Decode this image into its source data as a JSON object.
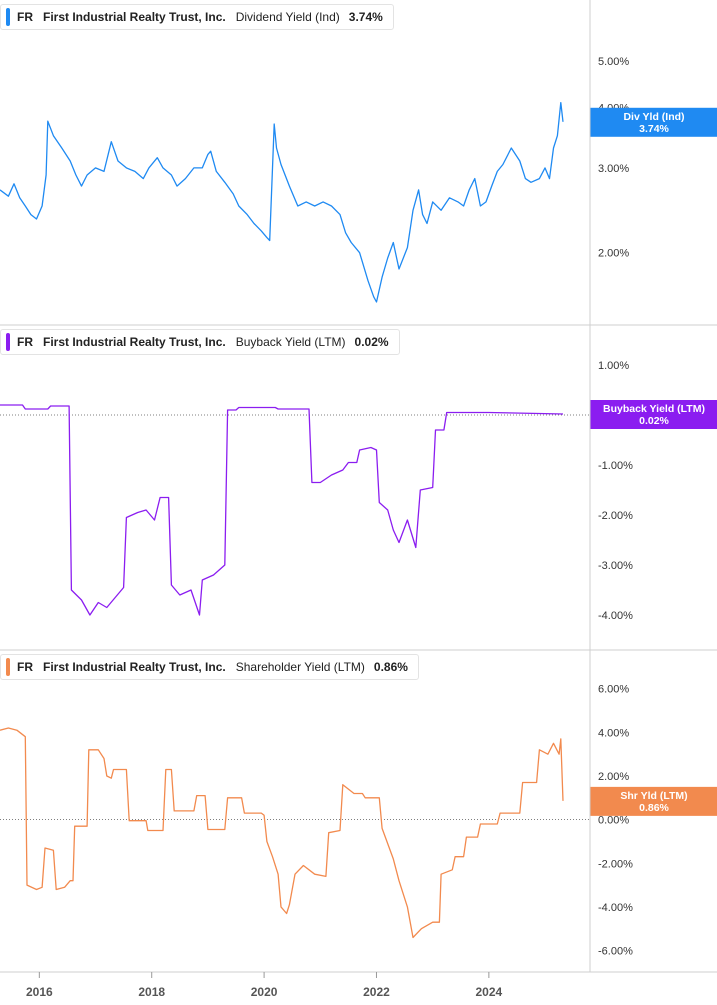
{
  "chart_data": {
    "type": "line",
    "x_axis": {
      "tick_labels": [
        "2016",
        "2018",
        "2020",
        "2022",
        "2024"
      ],
      "range": [
        2015.3,
        2025.8
      ]
    },
    "panels": [
      {
        "ticker": "FR",
        "company": "First Industrial Realty Trust, Inc.",
        "metric": "Dividend Yield (Ind)",
        "value": "3.74%",
        "color": "#1f8af2",
        "scale": "log",
        "ylim": [
          1.45,
          5.8
        ],
        "y_ticks": [
          {
            "v": 5.0,
            "label": "5.00%"
          },
          {
            "v": 4.0,
            "label": "4.00%"
          },
          {
            "v": 3.0,
            "label": "3.00%"
          },
          {
            "v": 2.0,
            "label": "2.00%"
          }
        ],
        "badge": {
          "label": "Div Yld (Ind)",
          "value": "3.74%",
          "at": 3.74
        },
        "zero_line": false,
        "series": [
          {
            "x": 2015.3,
            "y": 2.7
          },
          {
            "x": 2015.45,
            "y": 2.62
          },
          {
            "x": 2015.55,
            "y": 2.78
          },
          {
            "x": 2015.65,
            "y": 2.6
          },
          {
            "x": 2015.75,
            "y": 2.5
          },
          {
            "x": 2015.85,
            "y": 2.4
          },
          {
            "x": 2015.95,
            "y": 2.35
          },
          {
            "x": 2016.05,
            "y": 2.5
          },
          {
            "x": 2016.12,
            "y": 2.9
          },
          {
            "x": 2016.15,
            "y": 3.75
          },
          {
            "x": 2016.25,
            "y": 3.5
          },
          {
            "x": 2016.4,
            "y": 3.3
          },
          {
            "x": 2016.55,
            "y": 3.1
          },
          {
            "x": 2016.65,
            "y": 2.9
          },
          {
            "x": 2016.75,
            "y": 2.75
          },
          {
            "x": 2016.85,
            "y": 2.9
          },
          {
            "x": 2017.0,
            "y": 3.0
          },
          {
            "x": 2017.15,
            "y": 2.95
          },
          {
            "x": 2017.28,
            "y": 3.4
          },
          {
            "x": 2017.4,
            "y": 3.1
          },
          {
            "x": 2017.55,
            "y": 3.0
          },
          {
            "x": 2017.7,
            "y": 2.95
          },
          {
            "x": 2017.85,
            "y": 2.85
          },
          {
            "x": 2017.95,
            "y": 3.0
          },
          {
            "x": 2018.1,
            "y": 3.15
          },
          {
            "x": 2018.2,
            "y": 3.0
          },
          {
            "x": 2018.35,
            "y": 2.9
          },
          {
            "x": 2018.45,
            "y": 2.75
          },
          {
            "x": 2018.6,
            "y": 2.85
          },
          {
            "x": 2018.75,
            "y": 3.0
          },
          {
            "x": 2018.9,
            "y": 3.0
          },
          {
            "x": 2019.0,
            "y": 3.2
          },
          {
            "x": 2019.05,
            "y": 3.25
          },
          {
            "x": 2019.15,
            "y": 2.95
          },
          {
            "x": 2019.3,
            "y": 2.8
          },
          {
            "x": 2019.45,
            "y": 2.65
          },
          {
            "x": 2019.55,
            "y": 2.5
          },
          {
            "x": 2019.7,
            "y": 2.4
          },
          {
            "x": 2019.82,
            "y": 2.3
          },
          {
            "x": 2019.95,
            "y": 2.22
          },
          {
            "x": 2020.05,
            "y": 2.15
          },
          {
            "x": 2020.1,
            "y": 2.12
          },
          {
            "x": 2020.18,
            "y": 3.7
          },
          {
            "x": 2020.22,
            "y": 3.3
          },
          {
            "x": 2020.3,
            "y": 3.05
          },
          {
            "x": 2020.45,
            "y": 2.75
          },
          {
            "x": 2020.6,
            "y": 2.5
          },
          {
            "x": 2020.75,
            "y": 2.55
          },
          {
            "x": 2020.9,
            "y": 2.5
          },
          {
            "x": 2021.05,
            "y": 2.55
          },
          {
            "x": 2021.2,
            "y": 2.5
          },
          {
            "x": 2021.35,
            "y": 2.4
          },
          {
            "x": 2021.45,
            "y": 2.2
          },
          {
            "x": 2021.55,
            "y": 2.1
          },
          {
            "x": 2021.7,
            "y": 2.0
          },
          {
            "x": 2021.85,
            "y": 1.75
          },
          {
            "x": 2021.95,
            "y": 1.62
          },
          {
            "x": 2022.0,
            "y": 1.58
          },
          {
            "x": 2022.1,
            "y": 1.78
          },
          {
            "x": 2022.2,
            "y": 1.95
          },
          {
            "x": 2022.3,
            "y": 2.1
          },
          {
            "x": 2022.4,
            "y": 1.85
          },
          {
            "x": 2022.55,
            "y": 2.05
          },
          {
            "x": 2022.65,
            "y": 2.45
          },
          {
            "x": 2022.75,
            "y": 2.7
          },
          {
            "x": 2022.82,
            "y": 2.4
          },
          {
            "x": 2022.9,
            "y": 2.3
          },
          {
            "x": 2023.0,
            "y": 2.55
          },
          {
            "x": 2023.15,
            "y": 2.45
          },
          {
            "x": 2023.3,
            "y": 2.6
          },
          {
            "x": 2023.45,
            "y": 2.55
          },
          {
            "x": 2023.55,
            "y": 2.5
          },
          {
            "x": 2023.65,
            "y": 2.7
          },
          {
            "x": 2023.75,
            "y": 2.85
          },
          {
            "x": 2023.85,
            "y": 2.5
          },
          {
            "x": 2023.95,
            "y": 2.55
          },
          {
            "x": 2024.05,
            "y": 2.75
          },
          {
            "x": 2024.15,
            "y": 2.95
          },
          {
            "x": 2024.25,
            "y": 3.05
          },
          {
            "x": 2024.4,
            "y": 3.3
          },
          {
            "x": 2024.55,
            "y": 3.1
          },
          {
            "x": 2024.65,
            "y": 2.85
          },
          {
            "x": 2024.75,
            "y": 2.8
          },
          {
            "x": 2024.9,
            "y": 2.85
          },
          {
            "x": 2025.0,
            "y": 3.0
          },
          {
            "x": 2025.08,
            "y": 2.85
          },
          {
            "x": 2025.15,
            "y": 3.3
          },
          {
            "x": 2025.22,
            "y": 3.5
          },
          {
            "x": 2025.28,
            "y": 4.1
          },
          {
            "x": 2025.32,
            "y": 3.74
          }
        ]
      },
      {
        "ticker": "FR",
        "company": "First Industrial Realty Trust, Inc.",
        "metric": "Buyback Yield (LTM)",
        "value": "0.02%",
        "color": "#8b1df0",
        "scale": "linear",
        "ylim": [
          -4.6,
          1.2
        ],
        "y_ticks": [
          {
            "v": 1.0,
            "label": "1.00%"
          },
          {
            "v": -1.0,
            "label": "-1.00%"
          },
          {
            "v": -2.0,
            "label": "-2.00%"
          },
          {
            "v": -3.0,
            "label": "-3.00%"
          },
          {
            "v": -4.0,
            "label": "-4.00%"
          }
        ],
        "badge": {
          "label": "Buyback Yield (LTM)",
          "value": "0.02%",
          "at": 0.02
        },
        "zero_line": true,
        "series": [
          {
            "x": 2015.3,
            "y": 0.2
          },
          {
            "x": 2015.7,
            "y": 0.2
          },
          {
            "x": 2015.75,
            "y": 0.12
          },
          {
            "x": 2016.15,
            "y": 0.12
          },
          {
            "x": 2016.2,
            "y": 0.18
          },
          {
            "x": 2016.53,
            "y": 0.18
          },
          {
            "x": 2016.57,
            "y": -3.5
          },
          {
            "x": 2016.75,
            "y": -3.7
          },
          {
            "x": 2016.9,
            "y": -4.0
          },
          {
            "x": 2017.05,
            "y": -3.75
          },
          {
            "x": 2017.2,
            "y": -3.85
          },
          {
            "x": 2017.35,
            "y": -3.65
          },
          {
            "x": 2017.5,
            "y": -3.45
          },
          {
            "x": 2017.55,
            "y": -2.05
          },
          {
            "x": 2017.75,
            "y": -1.95
          },
          {
            "x": 2017.9,
            "y": -1.9
          },
          {
            "x": 2018.05,
            "y": -2.1
          },
          {
            "x": 2018.15,
            "y": -1.65
          },
          {
            "x": 2018.3,
            "y": -1.65
          },
          {
            "x": 2018.35,
            "y": -3.4
          },
          {
            "x": 2018.5,
            "y": -3.6
          },
          {
            "x": 2018.7,
            "y": -3.5
          },
          {
            "x": 2018.85,
            "y": -4.0
          },
          {
            "x": 2018.9,
            "y": -3.3
          },
          {
            "x": 2019.1,
            "y": -3.2
          },
          {
            "x": 2019.3,
            "y": -3.0
          },
          {
            "x": 2019.35,
            "y": 0.1
          },
          {
            "x": 2019.5,
            "y": 0.1
          },
          {
            "x": 2019.55,
            "y": 0.15
          },
          {
            "x": 2020.2,
            "y": 0.15
          },
          {
            "x": 2020.25,
            "y": 0.12
          },
          {
            "x": 2020.8,
            "y": 0.12
          },
          {
            "x": 2020.85,
            "y": -1.35
          },
          {
            "x": 2021.0,
            "y": -1.35
          },
          {
            "x": 2021.2,
            "y": -1.2
          },
          {
            "x": 2021.4,
            "y": -1.1
          },
          {
            "x": 2021.5,
            "y": -0.95
          },
          {
            "x": 2021.65,
            "y": -0.95
          },
          {
            "x": 2021.7,
            "y": -0.7
          },
          {
            "x": 2021.9,
            "y": -0.65
          },
          {
            "x": 2022.0,
            "y": -0.7
          },
          {
            "x": 2022.05,
            "y": -1.75
          },
          {
            "x": 2022.2,
            "y": -1.9
          },
          {
            "x": 2022.3,
            "y": -2.3
          },
          {
            "x": 2022.4,
            "y": -2.55
          },
          {
            "x": 2022.55,
            "y": -2.1
          },
          {
            "x": 2022.7,
            "y": -2.65
          },
          {
            "x": 2022.78,
            "y": -1.5
          },
          {
            "x": 2023.0,
            "y": -1.45
          },
          {
            "x": 2023.05,
            "y": -0.3
          },
          {
            "x": 2023.2,
            "y": -0.3
          },
          {
            "x": 2023.25,
            "y": 0.05
          },
          {
            "x": 2024.0,
            "y": 0.05
          },
          {
            "x": 2025.32,
            "y": 0.02
          }
        ]
      },
      {
        "ticker": "FR",
        "company": "First Industrial Realty Trust, Inc.",
        "metric": "Shareholder Yield (LTM)",
        "value": "0.86%",
        "color": "#f28a4e",
        "scale": "linear",
        "ylim": [
          -6.8,
          6.4
        ],
        "y_ticks": [
          {
            "v": 6.0,
            "label": "6.00%"
          },
          {
            "v": 4.0,
            "label": "4.00%"
          },
          {
            "v": 2.0,
            "label": "2.00%"
          },
          {
            "v": 0.0,
            "label": "0.00%"
          },
          {
            "v": -2.0,
            "label": "-2.00%"
          },
          {
            "v": -4.0,
            "label": "-4.00%"
          },
          {
            "v": -6.0,
            "label": "-6.00%"
          }
        ],
        "badge": {
          "label": "Shr Yld (LTM)",
          "value": "0.86%",
          "at": 0.86
        },
        "zero_line": true,
        "series": [
          {
            "x": 2015.3,
            "y": 4.1
          },
          {
            "x": 2015.45,
            "y": 4.2
          },
          {
            "x": 2015.6,
            "y": 4.1
          },
          {
            "x": 2015.75,
            "y": 3.8
          },
          {
            "x": 2015.78,
            "y": -3.0
          },
          {
            "x": 2015.95,
            "y": -3.2
          },
          {
            "x": 2016.05,
            "y": -3.1
          },
          {
            "x": 2016.1,
            "y": -1.3
          },
          {
            "x": 2016.25,
            "y": -1.4
          },
          {
            "x": 2016.3,
            "y": -3.2
          },
          {
            "x": 2016.45,
            "y": -3.1
          },
          {
            "x": 2016.55,
            "y": -2.8
          },
          {
            "x": 2016.6,
            "y": -2.8
          },
          {
            "x": 2016.63,
            "y": -0.3
          },
          {
            "x": 2016.85,
            "y": -0.3
          },
          {
            "x": 2016.88,
            "y": 3.2
          },
          {
            "x": 2017.05,
            "y": 3.2
          },
          {
            "x": 2017.15,
            "y": 2.8
          },
          {
            "x": 2017.2,
            "y": 2.0
          },
          {
            "x": 2017.28,
            "y": 1.9
          },
          {
            "x": 2017.32,
            "y": 2.3
          },
          {
            "x": 2017.55,
            "y": 2.3
          },
          {
            "x": 2017.6,
            "y": -0.05
          },
          {
            "x": 2017.9,
            "y": -0.05
          },
          {
            "x": 2017.93,
            "y": -0.5
          },
          {
            "x": 2018.2,
            "y": -0.5
          },
          {
            "x": 2018.25,
            "y": 2.3
          },
          {
            "x": 2018.35,
            "y": 2.3
          },
          {
            "x": 2018.4,
            "y": 0.4
          },
          {
            "x": 2018.75,
            "y": 0.4
          },
          {
            "x": 2018.8,
            "y": 1.1
          },
          {
            "x": 2018.95,
            "y": 1.1
          },
          {
            "x": 2019.0,
            "y": -0.45
          },
          {
            "x": 2019.3,
            "y": -0.45
          },
          {
            "x": 2019.35,
            "y": 1.0
          },
          {
            "x": 2019.6,
            "y": 1.0
          },
          {
            "x": 2019.65,
            "y": 0.3
          },
          {
            "x": 2019.95,
            "y": 0.3
          },
          {
            "x": 2020.0,
            "y": 0.2
          },
          {
            "x": 2020.05,
            "y": -1.0
          },
          {
            "x": 2020.15,
            "y": -1.7
          },
          {
            "x": 2020.25,
            "y": -2.5
          },
          {
            "x": 2020.3,
            "y": -4.0
          },
          {
            "x": 2020.4,
            "y": -4.3
          },
          {
            "x": 2020.45,
            "y": -3.9
          },
          {
            "x": 2020.55,
            "y": -2.5
          },
          {
            "x": 2020.7,
            "y": -2.1
          },
          {
            "x": 2020.9,
            "y": -2.5
          },
          {
            "x": 2021.1,
            "y": -2.6
          },
          {
            "x": 2021.15,
            "y": -0.6
          },
          {
            "x": 2021.35,
            "y": -0.5
          },
          {
            "x": 2021.4,
            "y": 1.6
          },
          {
            "x": 2021.6,
            "y": 1.2
          },
          {
            "x": 2021.75,
            "y": 1.2
          },
          {
            "x": 2021.8,
            "y": 1.0
          },
          {
            "x": 2022.05,
            "y": 1.0
          },
          {
            "x": 2022.1,
            "y": -0.4
          },
          {
            "x": 2022.3,
            "y": -1.8
          },
          {
            "x": 2022.4,
            "y": -2.8
          },
          {
            "x": 2022.55,
            "y": -4.0
          },
          {
            "x": 2022.65,
            "y": -5.4
          },
          {
            "x": 2022.8,
            "y": -5.0
          },
          {
            "x": 2023.0,
            "y": -4.7
          },
          {
            "x": 2023.12,
            "y": -4.7
          },
          {
            "x": 2023.15,
            "y": -2.5
          },
          {
            "x": 2023.35,
            "y": -2.3
          },
          {
            "x": 2023.4,
            "y": -1.7
          },
          {
            "x": 2023.55,
            "y": -1.7
          },
          {
            "x": 2023.6,
            "y": -0.8
          },
          {
            "x": 2023.8,
            "y": -0.8
          },
          {
            "x": 2023.85,
            "y": -0.2
          },
          {
            "x": 2024.15,
            "y": -0.2
          },
          {
            "x": 2024.2,
            "y": 0.3
          },
          {
            "x": 2024.55,
            "y": 0.3
          },
          {
            "x": 2024.6,
            "y": 1.7
          },
          {
            "x": 2024.85,
            "y": 1.7
          },
          {
            "x": 2024.9,
            "y": 3.2
          },
          {
            "x": 2025.05,
            "y": 3.0
          },
          {
            "x": 2025.15,
            "y": 3.5
          },
          {
            "x": 2025.25,
            "y": 3.0
          },
          {
            "x": 2025.28,
            "y": 3.7
          },
          {
            "x": 2025.32,
            "y": 0.86
          }
        ]
      }
    ]
  }
}
